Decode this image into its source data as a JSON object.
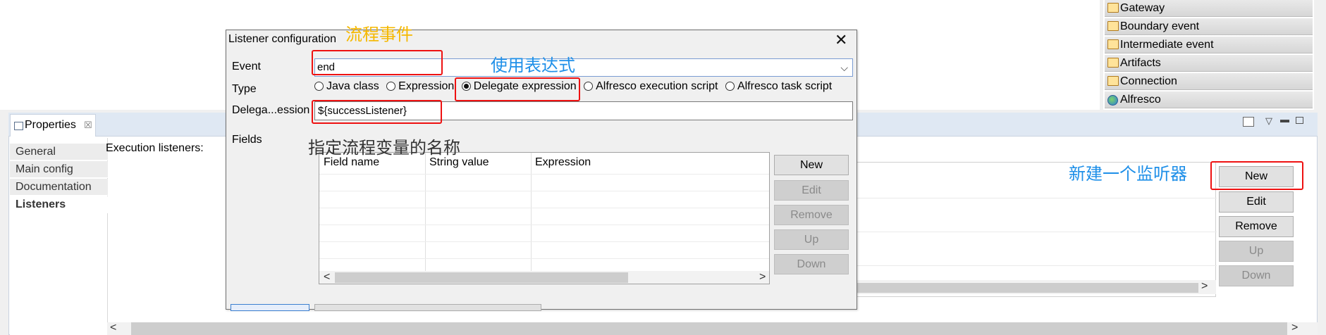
{
  "palette": {
    "items": [
      {
        "label": "Gateway",
        "icon": "folder-icon"
      },
      {
        "label": "Boundary event",
        "icon": "folder-icon"
      },
      {
        "label": "Intermediate event",
        "icon": "folder-icon"
      },
      {
        "label": "Artifacts",
        "icon": "folder-icon"
      },
      {
        "label": "Connection",
        "icon": "folder-icon"
      },
      {
        "label": "Alfresco",
        "icon": "globe-icon"
      }
    ]
  },
  "properties": {
    "tab_label": "Properties",
    "tab_close": "☒",
    "sidebar": [
      {
        "label": "General",
        "selected": false
      },
      {
        "label": "Main config",
        "selected": false
      },
      {
        "label": "Documentation",
        "selected": false
      },
      {
        "label": "Listeners",
        "selected": true
      }
    ],
    "section_label": "Execution listeners:",
    "buttons": {
      "new": "New",
      "edit": "Edit",
      "remove": "Remove",
      "up": "Up",
      "down": "Down"
    }
  },
  "dialog": {
    "title": "Listener configuration",
    "event_label": "Event",
    "event_value": "end",
    "type_label": "Type",
    "type_options": [
      {
        "label": "Java class",
        "selected": false
      },
      {
        "label": "Expression",
        "selected": false
      },
      {
        "label": "Delegate expression",
        "selected": true
      },
      {
        "label": "Alfresco execution script",
        "selected": false
      },
      {
        "label": "Alfresco task script",
        "selected": false
      }
    ],
    "delegate_label": "Delega...ession",
    "delegate_value": "${successListener}",
    "fields_label": "Fields",
    "fields_columns": [
      "Field name",
      "String value",
      "Expression"
    ],
    "field_buttons": {
      "new": "New",
      "edit": "Edit",
      "remove": "Remove",
      "up": "Up",
      "down": "Down"
    }
  },
  "annotations": {
    "process_event": "流程事件",
    "use_expression": "使用表达式",
    "specify_variable": "指定流程变量的名称",
    "new_listener": "新建一个监听器"
  },
  "colors": {
    "annotation_orange": "#f5b800",
    "annotation_blue": "#1e8fe8",
    "annotation_dark": "#333333",
    "highlight_red": "#ee1111"
  }
}
